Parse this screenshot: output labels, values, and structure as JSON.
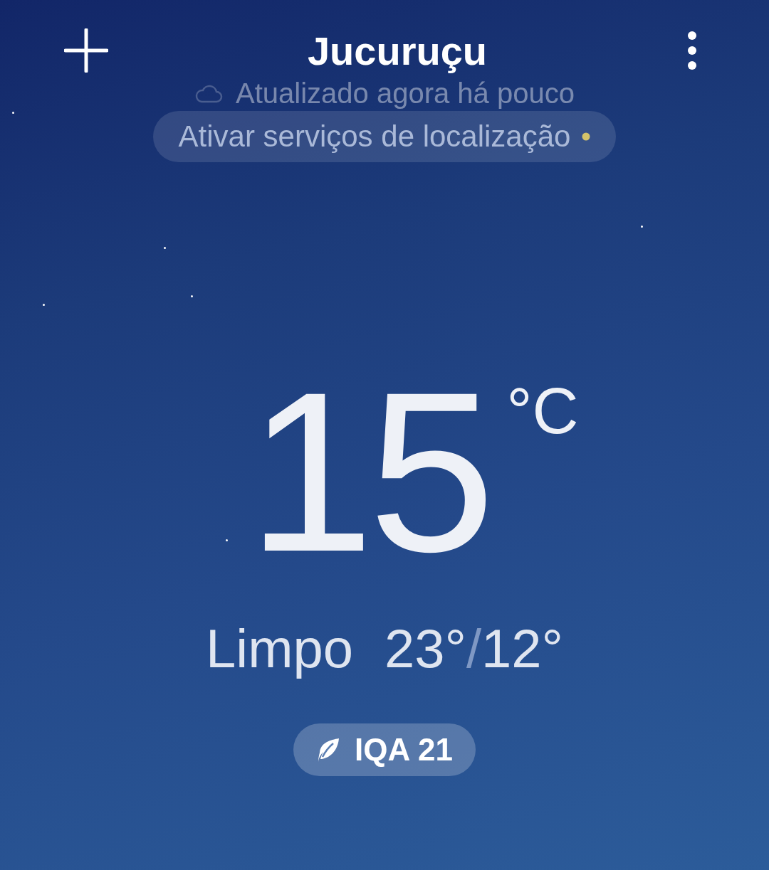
{
  "title": "Jucuruçu",
  "updated": "Atualizado agora há pouco",
  "location_prompt": "Ativar serviços de localização",
  "current": {
    "temperature": "15",
    "unit": "°C",
    "condition": "Limpo",
    "high": "23°",
    "separator": "/",
    "low": "12°"
  },
  "air_quality": "IQA 21"
}
